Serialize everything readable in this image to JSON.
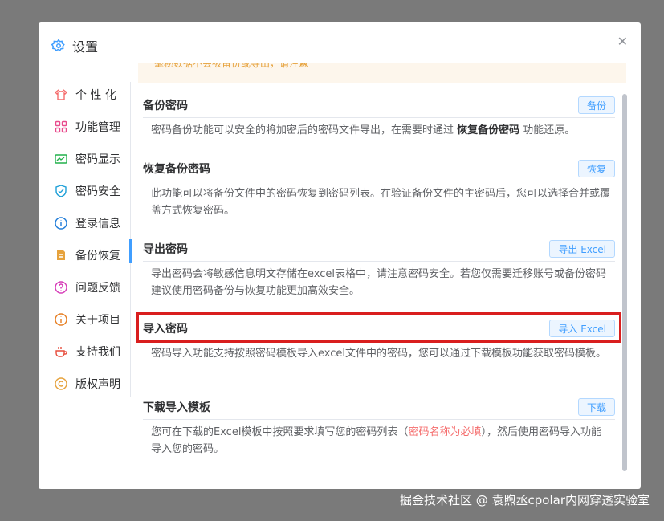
{
  "dialog": {
    "title": "设置",
    "close_icon": "close-icon"
  },
  "sidebar": {
    "items": [
      {
        "label": "个 性 化",
        "icon": "tshirt-icon",
        "color": "#f56c6c"
      },
      {
        "label": "功能管理",
        "icon": "grid-icon",
        "color": "#e84a8c"
      },
      {
        "label": "密码显示",
        "icon": "display-icon",
        "color": "#22b14c"
      },
      {
        "label": "密码安全",
        "icon": "shield-icon",
        "color": "#1ea0d8"
      },
      {
        "label": "登录信息",
        "icon": "info-icon",
        "color": "#1e7bd8"
      },
      {
        "label": "备份恢复",
        "icon": "backup-icon",
        "color": "#e6a23c"
      },
      {
        "label": "问题反馈",
        "icon": "question-icon",
        "color": "#d63ab7"
      },
      {
        "label": "关于项目",
        "icon": "about-icon",
        "color": "#e67e22"
      },
      {
        "label": "支持我们",
        "icon": "coffee-icon",
        "color": "#e74c3c"
      },
      {
        "label": "版权声明",
        "icon": "copyright-icon",
        "color": "#e6a23c"
      }
    ],
    "active": "备份恢复"
  },
  "notice": {
    "text": "毫秘数据不会被备份或导出，请注意"
  },
  "sections": [
    {
      "title": "备份密码",
      "button": "备份",
      "desc_pre": "密码备份功能可以安全的将加密后的密码文件导出，在需要时通过 ",
      "desc_highlight": "恢复备份密码",
      "desc_post": " 功能还原。"
    },
    {
      "title": "恢复备份密码",
      "button": "恢复",
      "desc": "此功能可以将备份文件中的密码恢复到密码列表。在验证备份文件的主密码后，您可以选择合并或覆盖方式恢复密码。"
    },
    {
      "title": "导出密码",
      "button": "导出 Excel",
      "desc": "导出密码会将敏感信息明文存储在excel表格中，请注意密码安全。若您仅需要迁移账号或备份密码建议使用密码备份与恢复功能更加高效安全。"
    },
    {
      "title": "导入密码",
      "button": "导入 Excel",
      "desc": "密码导入功能支持按照密码模板导入excel文件中的密码，您可以通过下载模板功能获取密码模板。"
    },
    {
      "title": "下载导入模板",
      "button": "下载",
      "desc_pre": "您可在下载的Excel模板中按照要求填写您的密码列表（",
      "desc_red": "密码名称为必填",
      "desc_post": "），然后使用密码导入功能导入您的密码。"
    }
  ],
  "colors": {
    "accent": "#409eff",
    "highlight_box": "#d91e1e",
    "warning": "#e6a23c"
  },
  "watermark": "掘金技术社区 @ 袁煦丞cpolar内网穿透实验室"
}
